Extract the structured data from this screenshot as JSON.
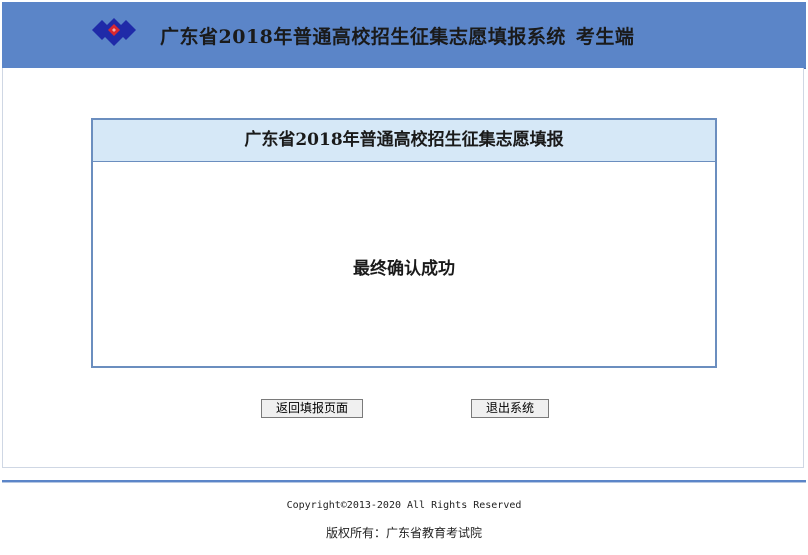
{
  "header": {
    "title": "广东省2018年普通高校招生征集志愿填报系统",
    "subtitle": "考生端",
    "logo_colors": [
      "#1f2aa8",
      "#d9282f"
    ]
  },
  "dialog": {
    "title": "广东省2018年普通高校招生征集志愿填报",
    "message": "最终确认成功"
  },
  "buttons": {
    "return_label": "返回填报页面",
    "exit_label": "退出系统"
  },
  "footer": {
    "copyright": "Copyright©2013-2020  All Rights Reserved",
    "owner": "版权所有：广东省教育考试院"
  },
  "colors": {
    "header_bg": "#5b85c8",
    "dialog_header_bg": "#d6e8f7",
    "dialog_border": "#6b8ebf"
  }
}
